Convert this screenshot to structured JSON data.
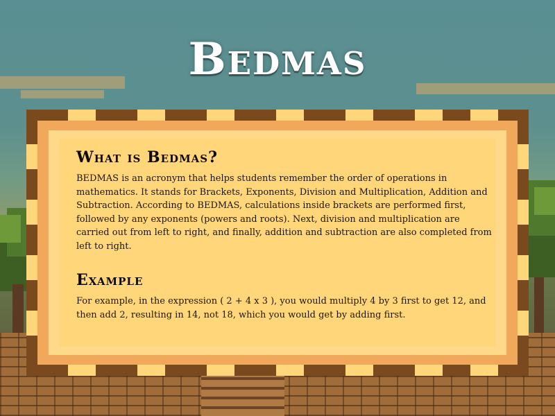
{
  "page": {
    "title": "Bedmas"
  },
  "sections": [
    {
      "heading": "What is Bedmas?",
      "body": "BEDMAS is an acronym that helps students remember the order of operations in mathematics. It stands for Brackets, Exponents, Division and Multiplication, Addition and Subtraction. According to BEDMAS, calculations inside brackets are performed first, followed by any exponents (powers and roots). Next, division and multiplication are carried out from left to right, and finally, addition and subtraction are also completed from left to right."
    },
    {
      "heading": "Example",
      "body": "For example, in the expression ( 2 + 4 x 3 ), you would multiply 4 by 3 first to get 12, and then add 2, resulting in 14, not 18, which you would get by adding first."
    }
  ],
  "colors": {
    "sky": "#5a8f93",
    "frame_dark": "#7a4a1e",
    "frame_mid": "#f2a85a",
    "paper": "#ffd77a",
    "title_text": "#ffffff",
    "body_text": "#1c1409"
  }
}
